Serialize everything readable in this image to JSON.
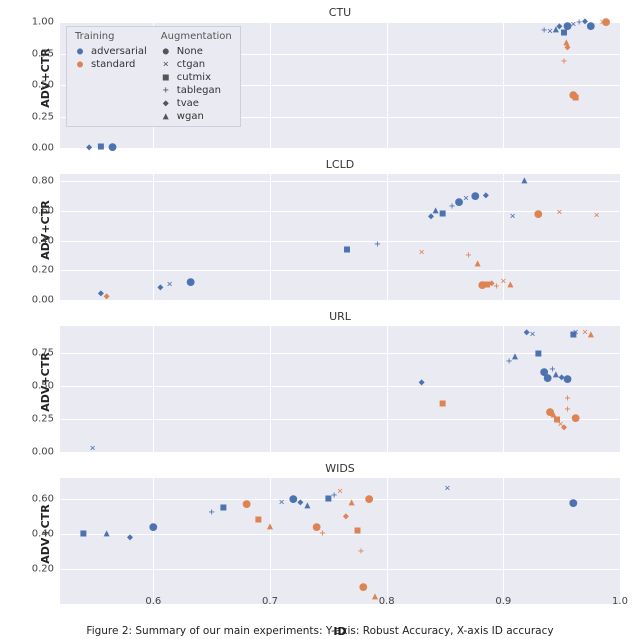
{
  "caption": "Figure 2: Summary of our main experiments: Y-axis: Robust Accuracy, X-axis ID accuracy",
  "legend_hue": {
    "title": "Training",
    "items": [
      {
        "label": "adversarial",
        "color_class": "c0"
      },
      {
        "label": "standard",
        "color_class": "c1"
      }
    ]
  },
  "legend_style": {
    "title": "Augmentation",
    "items": [
      {
        "label": "None",
        "glyph": "●"
      },
      {
        "label": "ctgan",
        "glyph": "×"
      },
      {
        "label": "cutmix",
        "glyph": "■"
      },
      {
        "label": "tablegan",
        "glyph": "+"
      },
      {
        "label": "tvae",
        "glyph": "◆"
      },
      {
        "label": "wgan",
        "glyph": "▲"
      }
    ]
  },
  "xaxis": {
    "label": "ID",
    "min": 0.52,
    "max": 1.0,
    "ticks": [
      0.6,
      0.7,
      0.8,
      0.9,
      1.0
    ]
  },
  "yaxis_label": "ADV+CTR",
  "chart_data": [
    {
      "title": "CTU",
      "ylim": [
        0,
        1.0
      ],
      "yticks": [
        0.0,
        0.25,
        0.5,
        0.75,
        1.0
      ],
      "points": [
        {
          "x": 0.545,
          "y": 0.0,
          "h": "adversarial",
          "s": "tvae"
        },
        {
          "x": 0.555,
          "y": 0.01,
          "h": "adversarial",
          "s": "cutmix"
        },
        {
          "x": 0.565,
          "y": 0.01,
          "h": "adversarial",
          "s": "None"
        },
        {
          "x": 0.935,
          "y": 0.93,
          "h": "adversarial",
          "s": "tablegan"
        },
        {
          "x": 0.94,
          "y": 0.92,
          "h": "adversarial",
          "s": "ctgan"
        },
        {
          "x": 0.945,
          "y": 0.94,
          "h": "adversarial",
          "s": "wgan"
        },
        {
          "x": 0.948,
          "y": 0.96,
          "h": "adversarial",
          "s": "tvae"
        },
        {
          "x": 0.952,
          "y": 0.91,
          "h": "adversarial",
          "s": "cutmix"
        },
        {
          "x": 0.955,
          "y": 0.97,
          "h": "adversarial",
          "s": "None"
        },
        {
          "x": 0.96,
          "y": 0.98,
          "h": "adversarial",
          "s": "ctgan"
        },
        {
          "x": 0.965,
          "y": 0.99,
          "h": "adversarial",
          "s": "tablegan"
        },
        {
          "x": 0.97,
          "y": 1.0,
          "h": "adversarial",
          "s": "tvae"
        },
        {
          "x": 0.975,
          "y": 0.97,
          "h": "adversarial",
          "s": "None"
        },
        {
          "x": 0.954,
          "y": 0.83,
          "h": "standard",
          "s": "wgan"
        },
        {
          "x": 0.955,
          "y": 0.79,
          "h": "standard",
          "s": "tvae"
        },
        {
          "x": 0.96,
          "y": 0.42,
          "h": "standard",
          "s": "None"
        },
        {
          "x": 0.962,
          "y": 0.4,
          "h": "standard",
          "s": "cutmix"
        },
        {
          "x": 0.952,
          "y": 0.68,
          "h": "standard",
          "s": "tablegan"
        },
        {
          "x": 0.985,
          "y": 0.99,
          "h": "standard",
          "s": "ctgan"
        },
        {
          "x": 0.988,
          "y": 1.0,
          "h": "standard",
          "s": "None"
        }
      ]
    },
    {
      "title": "LCLD",
      "ylim": [
        0,
        0.85
      ],
      "yticks": [
        0.0,
        0.2,
        0.4,
        0.6,
        0.8
      ],
      "points": [
        {
          "x": 0.555,
          "y": 0.04,
          "h": "adversarial",
          "s": "tvae"
        },
        {
          "x": 0.56,
          "y": 0.02,
          "h": "standard",
          "s": "tvae"
        },
        {
          "x": 0.606,
          "y": 0.08,
          "h": "adversarial",
          "s": "tvae"
        },
        {
          "x": 0.614,
          "y": 0.1,
          "h": "adversarial",
          "s": "ctgan"
        },
        {
          "x": 0.632,
          "y": 0.12,
          "h": "adversarial",
          "s": "None"
        },
        {
          "x": 0.766,
          "y": 0.34,
          "h": "adversarial",
          "s": "cutmix"
        },
        {
          "x": 0.792,
          "y": 0.37,
          "h": "adversarial",
          "s": "tablegan"
        },
        {
          "x": 0.83,
          "y": 0.32,
          "h": "standard",
          "s": "ctgan"
        },
        {
          "x": 0.838,
          "y": 0.56,
          "h": "adversarial",
          "s": "tvae"
        },
        {
          "x": 0.842,
          "y": 0.6,
          "h": "adversarial",
          "s": "wgan"
        },
        {
          "x": 0.848,
          "y": 0.58,
          "h": "adversarial",
          "s": "cutmix"
        },
        {
          "x": 0.856,
          "y": 0.63,
          "h": "adversarial",
          "s": "tablegan"
        },
        {
          "x": 0.862,
          "y": 0.66,
          "h": "adversarial",
          "s": "None"
        },
        {
          "x": 0.868,
          "y": 0.68,
          "h": "adversarial",
          "s": "ctgan"
        },
        {
          "x": 0.876,
          "y": 0.7,
          "h": "adversarial",
          "s": "None"
        },
        {
          "x": 0.885,
          "y": 0.7,
          "h": "adversarial",
          "s": "tvae"
        },
        {
          "x": 0.87,
          "y": 0.3,
          "h": "standard",
          "s": "tablegan"
        },
        {
          "x": 0.878,
          "y": 0.24,
          "h": "standard",
          "s": "wgan"
        },
        {
          "x": 0.882,
          "y": 0.1,
          "h": "standard",
          "s": "None"
        },
        {
          "x": 0.886,
          "y": 0.1,
          "h": "standard",
          "s": "cutmix"
        },
        {
          "x": 0.89,
          "y": 0.11,
          "h": "standard",
          "s": "tvae"
        },
        {
          "x": 0.894,
          "y": 0.09,
          "h": "standard",
          "s": "tablegan"
        },
        {
          "x": 0.9,
          "y": 0.12,
          "h": "standard",
          "s": "ctgan"
        },
        {
          "x": 0.906,
          "y": 0.1,
          "h": "standard",
          "s": "wgan"
        },
        {
          "x": 0.908,
          "y": 0.56,
          "h": "adversarial",
          "s": "ctgan"
        },
        {
          "x": 0.918,
          "y": 0.8,
          "h": "adversarial",
          "s": "wgan"
        },
        {
          "x": 0.93,
          "y": 0.58,
          "h": "standard",
          "s": "None"
        },
        {
          "x": 0.948,
          "y": 0.59,
          "h": "standard",
          "s": "ctgan"
        },
        {
          "x": 0.98,
          "y": 0.57,
          "h": "standard",
          "s": "ctgan"
        }
      ]
    },
    {
      "title": "URL",
      "ylim": [
        0,
        0.95
      ],
      "yticks": [
        0.0,
        0.25,
        0.5,
        0.75
      ],
      "points": [
        {
          "x": 0.548,
          "y": 0.02,
          "h": "adversarial",
          "s": "ctgan"
        },
        {
          "x": 0.83,
          "y": 0.52,
          "h": "adversarial",
          "s": "tvae"
        },
        {
          "x": 0.848,
          "y": 0.36,
          "h": "standard",
          "s": "cutmix"
        },
        {
          "x": 0.905,
          "y": 0.68,
          "h": "adversarial",
          "s": "tablegan"
        },
        {
          "x": 0.91,
          "y": 0.72,
          "h": "adversarial",
          "s": "wgan"
        },
        {
          "x": 0.92,
          "y": 0.9,
          "h": "adversarial",
          "s": "tvae"
        },
        {
          "x": 0.925,
          "y": 0.88,
          "h": "adversarial",
          "s": "ctgan"
        },
        {
          "x": 0.93,
          "y": 0.74,
          "h": "adversarial",
          "s": "cutmix"
        },
        {
          "x": 0.935,
          "y": 0.6,
          "h": "adversarial",
          "s": "None"
        },
        {
          "x": 0.938,
          "y": 0.56,
          "h": "adversarial",
          "s": "None"
        },
        {
          "x": 0.942,
          "y": 0.62,
          "h": "adversarial",
          "s": "tablegan"
        },
        {
          "x": 0.945,
          "y": 0.58,
          "h": "adversarial",
          "s": "wgan"
        },
        {
          "x": 0.95,
          "y": 0.56,
          "h": "adversarial",
          "s": "tvae"
        },
        {
          "x": 0.955,
          "y": 0.55,
          "h": "adversarial",
          "s": "None"
        },
        {
          "x": 0.96,
          "y": 0.88,
          "h": "adversarial",
          "s": "cutmix"
        },
        {
          "x": 0.962,
          "y": 0.9,
          "h": "adversarial",
          "s": "ctgan"
        },
        {
          "x": 0.955,
          "y": 0.4,
          "h": "standard",
          "s": "tablegan"
        },
        {
          "x": 0.94,
          "y": 0.3,
          "h": "standard",
          "s": "None"
        },
        {
          "x": 0.943,
          "y": 0.28,
          "h": "standard",
          "s": "wgan"
        },
        {
          "x": 0.946,
          "y": 0.24,
          "h": "standard",
          "s": "cutmix"
        },
        {
          "x": 0.949,
          "y": 0.2,
          "h": "standard",
          "s": "ctgan"
        },
        {
          "x": 0.952,
          "y": 0.18,
          "h": "standard",
          "s": "tvae"
        },
        {
          "x": 0.955,
          "y": 0.32,
          "h": "standard",
          "s": "tablegan"
        },
        {
          "x": 0.962,
          "y": 0.26,
          "h": "standard",
          "s": "None"
        },
        {
          "x": 0.97,
          "y": 0.9,
          "h": "standard",
          "s": "ctgan"
        },
        {
          "x": 0.975,
          "y": 0.88,
          "h": "standard",
          "s": "wgan"
        }
      ]
    },
    {
      "title": "WIDS",
      "ylim": [
        0,
        0.72
      ],
      "yticks": [
        0.2,
        0.4,
        0.6
      ],
      "points": [
        {
          "x": 0.54,
          "y": 0.4,
          "h": "adversarial",
          "s": "cutmix"
        },
        {
          "x": 0.56,
          "y": 0.4,
          "h": "adversarial",
          "s": "wgan"
        },
        {
          "x": 0.58,
          "y": 0.38,
          "h": "adversarial",
          "s": "tvae"
        },
        {
          "x": 0.6,
          "y": 0.44,
          "h": "adversarial",
          "s": "None"
        },
        {
          "x": 0.65,
          "y": 0.52,
          "h": "adversarial",
          "s": "tablegan"
        },
        {
          "x": 0.66,
          "y": 0.55,
          "h": "adversarial",
          "s": "cutmix"
        },
        {
          "x": 0.68,
          "y": 0.57,
          "h": "standard",
          "s": "None"
        },
        {
          "x": 0.69,
          "y": 0.48,
          "h": "standard",
          "s": "cutmix"
        },
        {
          "x": 0.7,
          "y": 0.44,
          "h": "standard",
          "s": "wgan"
        },
        {
          "x": 0.71,
          "y": 0.58,
          "h": "adversarial",
          "s": "ctgan"
        },
        {
          "x": 0.72,
          "y": 0.6,
          "h": "adversarial",
          "s": "None"
        },
        {
          "x": 0.726,
          "y": 0.58,
          "h": "adversarial",
          "s": "tvae"
        },
        {
          "x": 0.732,
          "y": 0.56,
          "h": "adversarial",
          "s": "wgan"
        },
        {
          "x": 0.74,
          "y": 0.44,
          "h": "standard",
          "s": "None"
        },
        {
          "x": 0.745,
          "y": 0.4,
          "h": "standard",
          "s": "tablegan"
        },
        {
          "x": 0.75,
          "y": 0.6,
          "h": "adversarial",
          "s": "cutmix"
        },
        {
          "x": 0.755,
          "y": 0.62,
          "h": "adversarial",
          "s": "tablegan"
        },
        {
          "x": 0.76,
          "y": 0.64,
          "h": "standard",
          "s": "ctgan"
        },
        {
          "x": 0.765,
          "y": 0.5,
          "h": "standard",
          "s": "tvae"
        },
        {
          "x": 0.77,
          "y": 0.58,
          "h": "standard",
          "s": "wgan"
        },
        {
          "x": 0.775,
          "y": 0.42,
          "h": "standard",
          "s": "cutmix"
        },
        {
          "x": 0.778,
          "y": 0.3,
          "h": "standard",
          "s": "tablegan"
        },
        {
          "x": 0.78,
          "y": 0.1,
          "h": "standard",
          "s": "None"
        },
        {
          "x": 0.785,
          "y": 0.6,
          "h": "standard",
          "s": "None"
        },
        {
          "x": 0.79,
          "y": 0.04,
          "h": "standard",
          "s": "wgan"
        },
        {
          "x": 0.852,
          "y": 0.66,
          "h": "adversarial",
          "s": "ctgan"
        },
        {
          "x": 0.96,
          "y": 0.58,
          "h": "adversarial",
          "s": "None"
        }
      ]
    }
  ]
}
